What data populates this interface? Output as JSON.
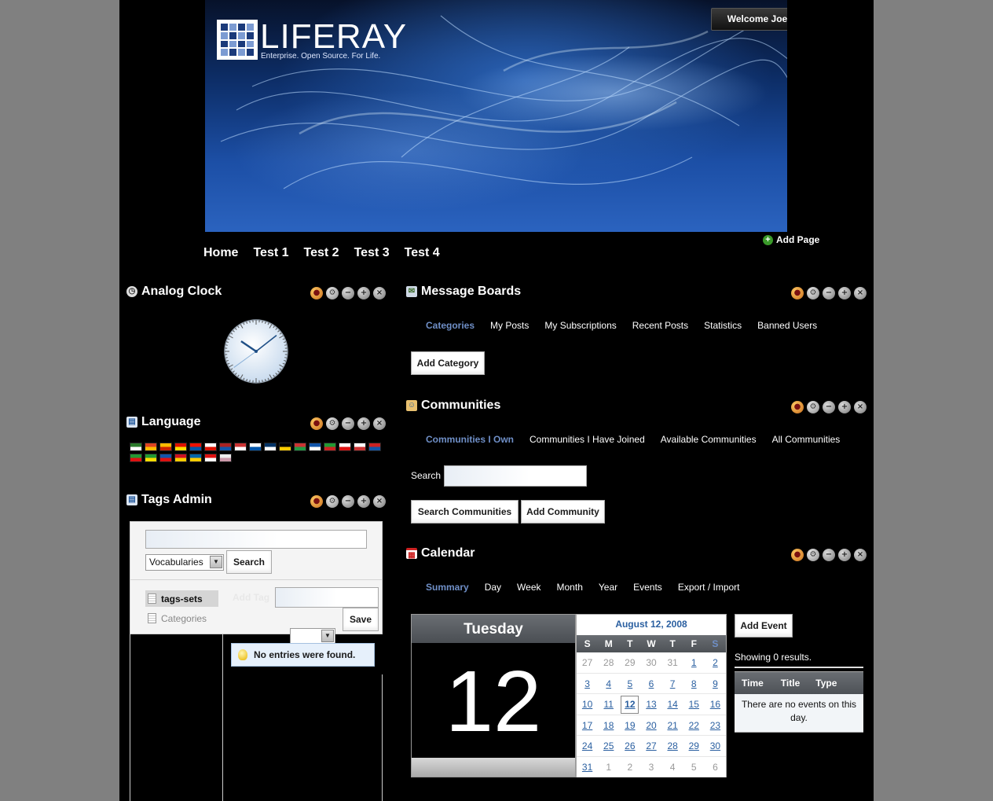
{
  "brand": {
    "logo_word": "LIFERAY",
    "tagline": "Enterprise. Open Source. For Life."
  },
  "header": {
    "welcome": "Welcome Joe Bloggs!",
    "add_page": "Add Page"
  },
  "nav": [
    "Home",
    "Test 1",
    "Test 2",
    "Test 3",
    "Test 4"
  ],
  "portlets": {
    "clock": {
      "title": "Analog Clock",
      "time": {
        "hour": 10,
        "minute": 8,
        "second": 39
      }
    },
    "language": {
      "title": "Language",
      "flag_colors": [
        [
          "#2a7a2a",
          "#fff"
        ],
        [
          "#d42",
          "#fb0"
        ],
        [
          "#fb0",
          "#c20"
        ],
        [
          "#d10",
          "#fd0"
        ],
        [
          "#e10",
          "#05a"
        ],
        [
          "#fff",
          "#d10"
        ],
        [
          "#a22",
          "#15a"
        ],
        [
          "#c33",
          "#fff"
        ],
        [
          "#fff",
          "#05a"
        ],
        [
          "#036",
          "#fff"
        ],
        [
          "#000",
          "#fc0"
        ],
        [
          "#c33",
          "#294"
        ],
        [
          "#15a",
          "#fff"
        ],
        [
          "#293",
          "#c22"
        ],
        [
          "#fff",
          "#d11"
        ],
        [
          "#fff",
          "#c33"
        ],
        [
          "#c22",
          "#15a"
        ],
        [
          "#293",
          "#d11"
        ],
        [
          "#293",
          "#fd0"
        ],
        [
          "#15a",
          "#d11"
        ],
        [
          "#c12",
          "#fc0"
        ],
        [
          "#06a",
          "#fc0"
        ],
        [
          "#d11",
          "#fff"
        ],
        [
          "#eee",
          "#c9a"
        ]
      ]
    },
    "tags_admin": {
      "title": "Tags Admin",
      "search_placeholder": "",
      "vocab_selected": "Vocabularies",
      "search_button": "Search",
      "add_tag_label": "Add Tag",
      "save_button": "Save",
      "sets": [
        "tags-sets",
        "Categories"
      ],
      "empty_message": "No entries were found."
    },
    "message_boards": {
      "title": "Message Boards",
      "tabs": [
        "Categories",
        "My Posts",
        "My Subscriptions",
        "Recent Posts",
        "Statistics",
        "Banned Users"
      ],
      "add_category": "Add Category"
    },
    "communities": {
      "title": "Communities",
      "tabs": [
        "Communities I Own",
        "Communities I Have Joined",
        "Available Communities",
        "All Communities"
      ],
      "search_label": "Search",
      "search_button": "Search Communities",
      "add_button": "Add Community"
    },
    "calendar": {
      "title": "Calendar",
      "tabs": [
        "Summary",
        "Day",
        "Week",
        "Month",
        "Year",
        "Events",
        "Export / Import"
      ],
      "day_name": "Tuesday",
      "day_number": "12",
      "month_heading": "August 12, 2008",
      "weekday_headers": [
        "S",
        "M",
        "T",
        "W",
        "T",
        "F",
        "S"
      ],
      "days": [
        [
          "27",
          "28",
          "29",
          "30",
          "31",
          "1",
          "2"
        ],
        [
          "3",
          "4",
          "5",
          "6",
          "7",
          "8",
          "9"
        ],
        [
          "10",
          "11",
          "12",
          "13",
          "14",
          "15",
          "16"
        ],
        [
          "17",
          "18",
          "19",
          "20",
          "21",
          "22",
          "23"
        ],
        [
          "24",
          "25",
          "26",
          "27",
          "28",
          "29",
          "30"
        ],
        [
          "31",
          "1",
          "2",
          "3",
          "4",
          "5",
          "6"
        ]
      ],
      "add_event": "Add Event",
      "results_text": "Showing 0 results.",
      "table_headers": [
        "Time",
        "Title",
        "Type"
      ],
      "empty_message": "There are no events on this day."
    }
  }
}
